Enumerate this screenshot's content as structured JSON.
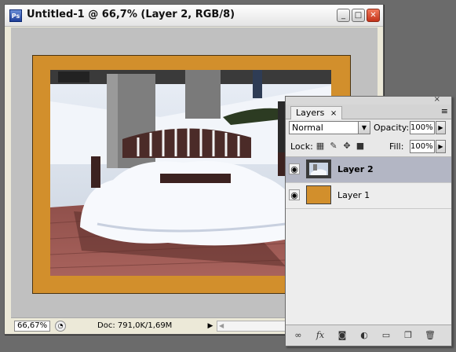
{
  "document": {
    "title": "Untitled-1 @ 66,7% (Layer 2, RGB/8)",
    "app_icon": "Ps",
    "window_buttons": {
      "minimize": "_",
      "maximize": "□",
      "close": "✕"
    },
    "status": {
      "zoom": "66,67%",
      "doc_info": "Doc: 791,0K/1,69M",
      "arrow": "▶",
      "scroll_left": "◀"
    },
    "colors": {
      "frame": "#d28f2c",
      "canvas_bg": "#c0c0c0"
    }
  },
  "layers_panel": {
    "tab_label": "Layers",
    "tab_close": "×",
    "menu_icon": "≡",
    "collapse": "×",
    "blend_mode": "Normal",
    "opacity_label": "Opacity:",
    "opacity_value": "100%",
    "lock_label": "Lock:",
    "fill_label": "Fill:",
    "fill_value": "100%",
    "layers": [
      {
        "name": "Layer 2",
        "selected": true,
        "thumbnail": "photo"
      },
      {
        "name": "Layer 1",
        "selected": false,
        "thumbnail": "orange"
      }
    ],
    "footer_icons": [
      "link-icon",
      "fx-icon",
      "mask-icon",
      "adjustment-icon",
      "folder-icon",
      "new-layer-icon",
      "trash-icon"
    ]
  }
}
